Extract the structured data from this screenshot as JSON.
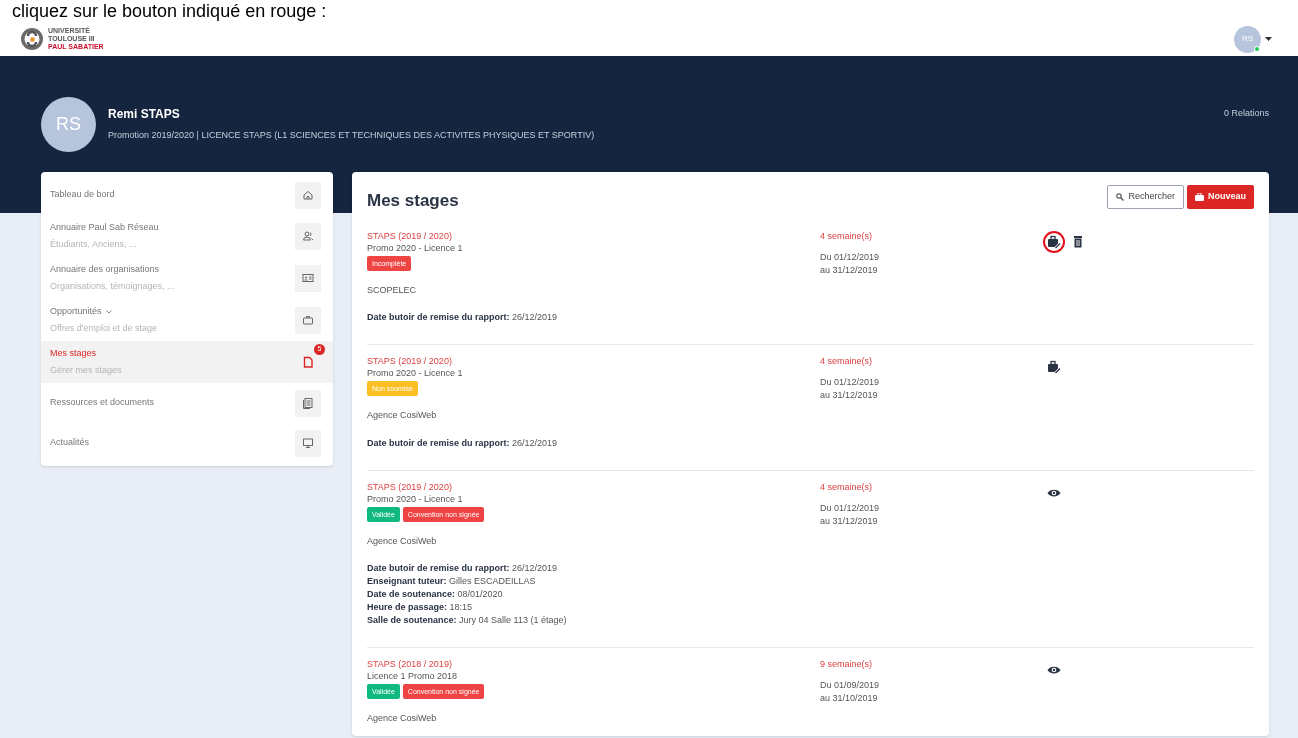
{
  "caption": "cliquez sur le bouton indiqué en rouge :",
  "logo": {
    "line_1": "UNIVERSITÉ",
    "line_2": "TOULOUSE III",
    "line_3": "PAUL SABATIER"
  },
  "user_menu": {
    "initials": "RS",
    "online": true
  },
  "profile": {
    "initials": "RS",
    "name": "Remi STAPS",
    "subtitle": "Promotion 2019/2020 | LICENCE STAPS (L1 SCIENCES ET TECHNIQUES DES ACTIVITES PHYSIQUES ET SPORTIV)",
    "relations": "0 Relations"
  },
  "sidebar": {
    "items": [
      {
        "title": "Tableau de bord",
        "kind": "home",
        "selected": false,
        "dropdown": false
      },
      {
        "title": "Annuaire Paul Sab Réseau",
        "subtitle": "Étudiants, Anciens, ...",
        "kind": "people",
        "selected": false,
        "dropdown": false
      },
      {
        "title": "Annuaire des organisations",
        "subtitle": "Organisations, témoignages, ...",
        "kind": "card",
        "selected": false,
        "dropdown": false
      },
      {
        "title": "Opportunités",
        "subtitle": "Offres d'emploi et de stage",
        "kind": "briefcase",
        "selected": false,
        "dropdown": true
      },
      {
        "title": "Mes stages",
        "subtitle": "Gérer mes stages",
        "kind": "file",
        "selected": true,
        "dropdown": false,
        "badge": "5"
      },
      {
        "title": "Ressources et documents",
        "kind": "docs",
        "selected": false,
        "dropdown": false
      },
      {
        "title": "Actualités",
        "kind": "monitor",
        "selected": false,
        "dropdown": false
      }
    ]
  },
  "main": {
    "title": "Mes stages",
    "search_button": "Rechercher",
    "new_button": "Nouveau",
    "internships": [
      {
        "program": "STAPS (2019 / 2020)",
        "promo": "Promo 2020 - Licence 1",
        "badges": [
          {
            "text": "Incomplète",
            "kind": "danger"
          }
        ],
        "company": "SCOPELEC",
        "details": [
          {
            "label": "Date butoir de remise du rapport:",
            "value": "26/12/2019"
          }
        ],
        "duration": "4 semaine(s)",
        "from": "Du 01/12/2019",
        "to": "au 31/12/2019",
        "actions": [
          {
            "kind": "edit",
            "highlighted": true
          },
          {
            "kind": "delete",
            "highlighted": false
          }
        ]
      },
      {
        "program": "STAPS (2019 / 2020)",
        "promo": "Promo 2020 - Licence 1",
        "badges": [
          {
            "text": "Non soumise",
            "kind": "warning"
          }
        ],
        "company": "Agence CosiWeb",
        "details": [
          {
            "label": "Date butoir de remise du rapport:",
            "value": "26/12/2019"
          }
        ],
        "duration": "4 semaine(s)",
        "from": "Du 01/12/2019",
        "to": "au 31/12/2019",
        "actions": [
          {
            "kind": "edit",
            "highlighted": false
          }
        ]
      },
      {
        "program": "STAPS (2019 / 2020)",
        "promo": "Promo 2020 - Licence 1",
        "badges": [
          {
            "text": "Validée",
            "kind": "success"
          },
          {
            "text": "Convention non signée",
            "kind": "danger"
          }
        ],
        "company": "Agence CosiWeb",
        "details": [
          {
            "label": "Date butoir de remise du rapport:",
            "value": "26/12/2019"
          },
          {
            "label": "Enseignant tuteur:",
            "value": "Gilles ESCADEILLAS"
          },
          {
            "label": "Date de soutenance:",
            "value": "08/01/2020"
          },
          {
            "label": "Heure de passage:",
            "value": "18:15"
          },
          {
            "label": "Salle de soutenance:",
            "value": "Jury 04 Salle 113 (1 étage)"
          }
        ],
        "duration": "4 semaine(s)",
        "from": "Du 01/12/2019",
        "to": "au 31/12/2019",
        "actions": [
          {
            "kind": "view",
            "highlighted": false
          }
        ]
      },
      {
        "program": "STAPS (2018 / 2019)",
        "promo": "Licence 1 Promo 2018",
        "badges": [
          {
            "text": "Validée",
            "kind": "success"
          },
          {
            "text": "Convention non signée",
            "kind": "danger"
          }
        ],
        "company": "Agence CosiWeb",
        "duration": "9 semaine(s)",
        "from": "Du 01/09/2019",
        "to": "au 31/10/2019",
        "actions": [
          {
            "kind": "view",
            "highlighted": false
          }
        ]
      }
    ]
  }
}
